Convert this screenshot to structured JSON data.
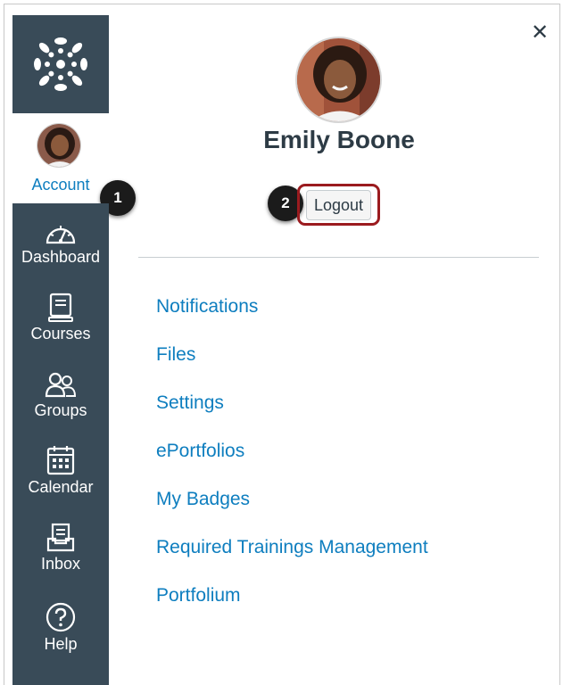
{
  "nav": {
    "account_label": "Account",
    "items": [
      {
        "label": "Dashboard",
        "icon": "dashboard-icon"
      },
      {
        "label": "Courses",
        "icon": "courses-icon"
      },
      {
        "label": "Groups",
        "icon": "groups-icon"
      },
      {
        "label": "Calendar",
        "icon": "calendar-icon"
      },
      {
        "label": "Inbox",
        "icon": "inbox-icon"
      },
      {
        "label": "Help",
        "icon": "help-icon"
      }
    ]
  },
  "callouts": {
    "one": "1",
    "two": "2"
  },
  "profile": {
    "name": "Emily Boone",
    "logout_label": "Logout",
    "close_glyph": "✕"
  },
  "links": [
    "Notifications",
    "Files",
    "Settings",
    "ePortfolios",
    "My Badges",
    "Required Trainings Management",
    "Portfolium"
  ],
  "colors": {
    "nav_bg": "#394b58",
    "link": "#0e7ebf",
    "highlight": "#9b1b1f",
    "text": "#2d3b45"
  }
}
